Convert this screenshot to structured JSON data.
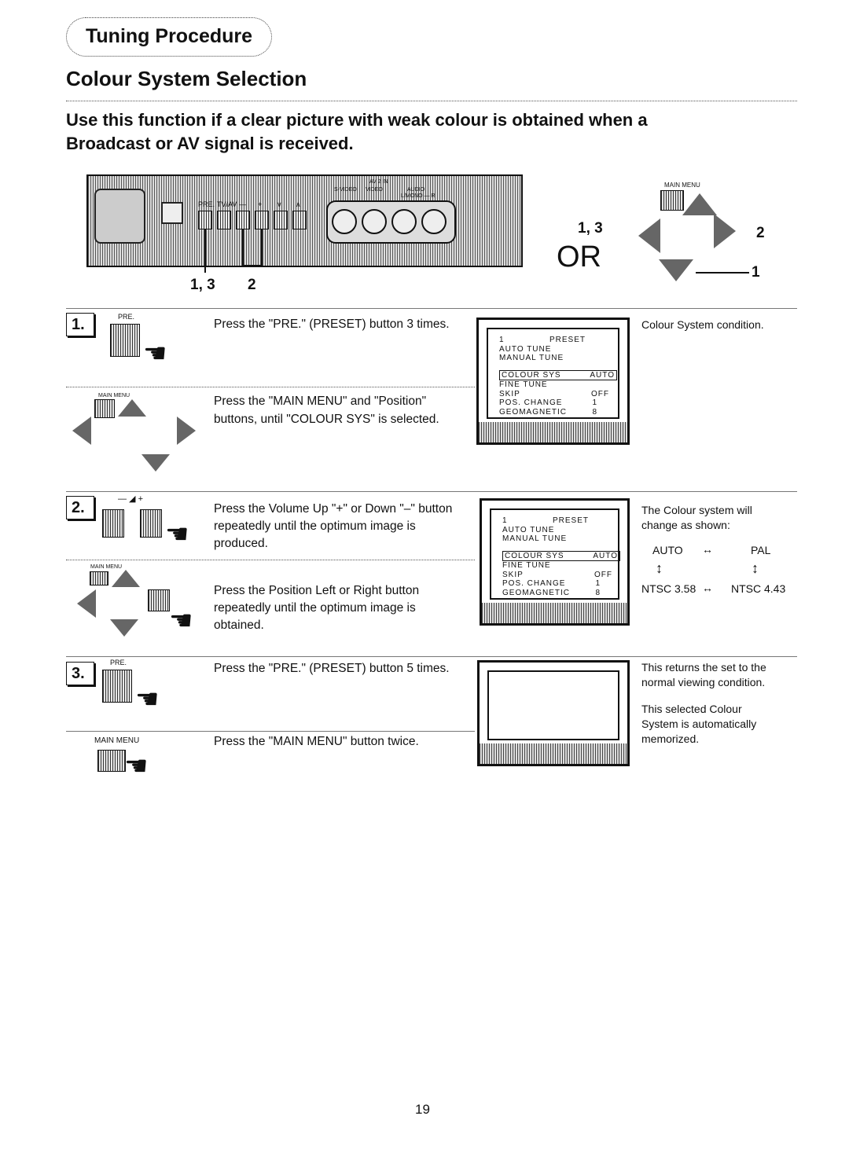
{
  "header": {
    "section": "Tuning Procedure",
    "title": "Colour System Selection",
    "intro": [
      "Use this function if a clear picture with weak colour is obtained when a",
      "Broadcast or AV signal is received."
    ]
  },
  "panel": {
    "labels": [
      "PRE.",
      "TV/AV",
      "—",
      "+",
      "∨",
      "∧"
    ],
    "av": "AV 2 IN",
    "svideo": "S-VIDEO",
    "video": "VIDEO",
    "audio": "AUDIO",
    "lmono": "L/MONO — R",
    "callout_13": "1, 3",
    "callout_2": "2"
  },
  "remote": {
    "main_menu": "MAIN MENU",
    "or": "OR",
    "callout_13": "1, 3",
    "callout_2": "2",
    "callout_1": "1"
  },
  "steps": [
    {
      "num": "1.",
      "btn_label": "PRE.",
      "text_a": "Press the \"PRE.\" (PRESET) button 3 times.",
      "main_menu": "MAIN MENU",
      "text_b": [
        "Press the \"MAIN MENU\" and \"Position\"",
        "buttons, until \"COLOUR SYS\" is selected."
      ],
      "note": "Colour System condition."
    },
    {
      "num": "2.",
      "vol_label": "— ◢ +",
      "text_a": [
        "Press the Volume Up \"+\" or Down \"–\" button",
        "repeatedly until the optimum image is",
        "produced."
      ],
      "main_menu": "MAIN MENU",
      "text_b": [
        "Press the Position Left or Right button",
        "repeatedly until the optimum image is",
        "obtained."
      ],
      "note": [
        "The Colour system will",
        "change as shown:"
      ],
      "cycle": {
        "auto": "AUTO",
        "pal": "PAL",
        "ntsc358": "NTSC 3.58",
        "ntsc443": "NTSC 4.43",
        "h_arrow": "↔",
        "v_arrow": "↕"
      }
    },
    {
      "num": "3.",
      "btn_label": "PRE.",
      "text_a": "Press the \"PRE.\" (PRESET) button 5 times.",
      "main_menu": "MAIN MENU",
      "text_b": "Press the \"MAIN MENU\" button twice.",
      "note_a": [
        "This returns the set to the",
        "normal viewing condition."
      ],
      "note_b": [
        "This selected Colour",
        "System is automatically",
        "memorized."
      ]
    }
  ],
  "menu": {
    "preset_num": "1",
    "preset": "PRESET",
    "auto_tune": "AUTO TUNE",
    "manual_tune": "MANUAL TUNE",
    "colour_sys": "COLOUR SYS",
    "colour_val": "AUTO",
    "fine_tune": "FINE TUNE",
    "skip": "SKIP",
    "skip_val": "OFF",
    "pos_change": "POS. CHANGE",
    "pos_val": "1",
    "geomagnetic": "GEOMAGNETIC",
    "geo_val": "8"
  },
  "page_number": "19"
}
